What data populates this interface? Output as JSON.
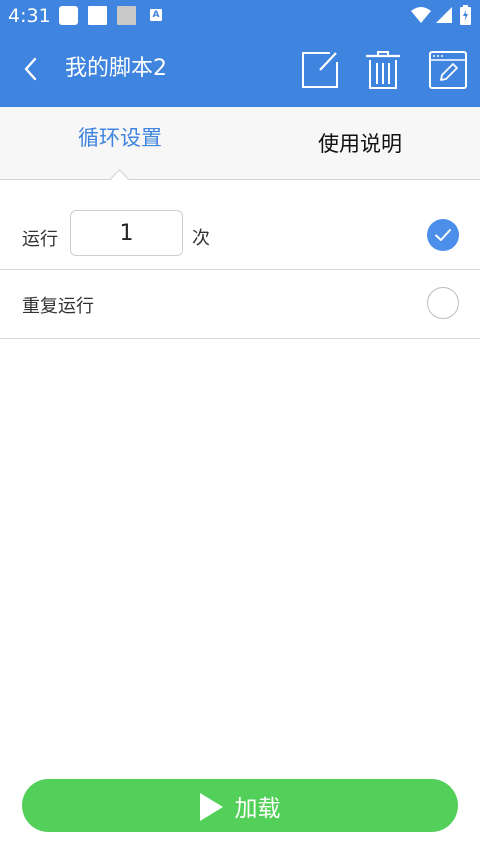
{
  "status_bar": {
    "time": "4:31",
    "notification_badge": "A"
  },
  "app_bar": {
    "title": "我的脚本2"
  },
  "tabs": [
    {
      "label": "循环设置",
      "active": true
    },
    {
      "label": "使用说明",
      "active": false
    }
  ],
  "loop_settings": {
    "run_label": "运行",
    "run_count": "1",
    "run_unit": "次",
    "run_selected": true,
    "repeat_label": "重复运行",
    "repeat_selected": false
  },
  "load_button": {
    "label": "加载"
  },
  "colors": {
    "primary": "#3f84de",
    "check": "#4b8fea",
    "load_button": "#52d05a"
  }
}
